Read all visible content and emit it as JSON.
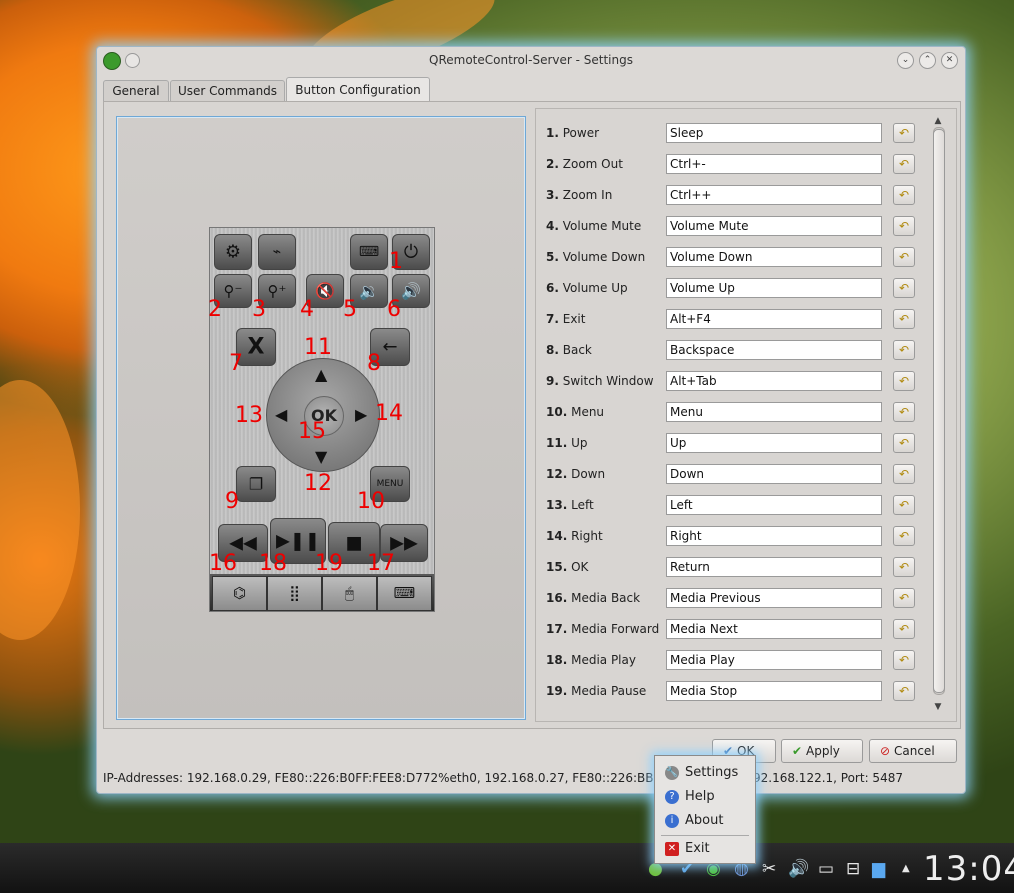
{
  "window": {
    "title": "QRemoteControl-Server - Settings",
    "controls": [
      "⌄",
      "⌃",
      "✕"
    ]
  },
  "tabs": [
    {
      "label": "General"
    },
    {
      "label": "User Commands"
    },
    {
      "label": "Button Configuration",
      "active": true
    }
  ],
  "remote": {
    "numbers": [
      "1",
      "2",
      "3",
      "4",
      "5",
      "6",
      "7",
      "8",
      "9",
      "10",
      "11",
      "12",
      "13",
      "14",
      "15",
      "16",
      "17",
      "18",
      "19"
    ],
    "ok_label": "OK",
    "menu_label": "MENU"
  },
  "buttons": [
    {
      "num": "1.",
      "name": "Power",
      "value": "Sleep"
    },
    {
      "num": "2.",
      "name": "Zoom Out",
      "value": "Ctrl+-"
    },
    {
      "num": "3.",
      "name": "Zoom In",
      "value": "Ctrl++"
    },
    {
      "num": "4.",
      "name": "Volume Mute",
      "value": "Volume Mute"
    },
    {
      "num": "5.",
      "name": "Volume Down",
      "value": "Volume Down"
    },
    {
      "num": "6.",
      "name": "Volume Up",
      "value": "Volume Up"
    },
    {
      "num": "7.",
      "name": "Exit",
      "value": "Alt+F4"
    },
    {
      "num": "8.",
      "name": "Back",
      "value": "Backspace"
    },
    {
      "num": "9.",
      "name": "Switch Window",
      "value": "Alt+Tab"
    },
    {
      "num": "10.",
      "name": "Menu",
      "value": "Menu"
    },
    {
      "num": "11.",
      "name": "Up",
      "value": "Up"
    },
    {
      "num": "12.",
      "name": "Down",
      "value": "Down"
    },
    {
      "num": "13.",
      "name": "Left",
      "value": "Left"
    },
    {
      "num": "14.",
      "name": "Right",
      "value": "Right"
    },
    {
      "num": "15.",
      "name": "OK",
      "value": "Return"
    },
    {
      "num": "16.",
      "name": "Media Back",
      "value": "Media Previous"
    },
    {
      "num": "17.",
      "name": "Media Forward",
      "value": "Media Next"
    },
    {
      "num": "18.",
      "name": "Media Play",
      "value": "Media Play"
    },
    {
      "num": "19.",
      "name": "Media Pause",
      "value": "Media Stop"
    }
  ],
  "dialog_buttons": {
    "ok": "OK",
    "apply": "Apply",
    "cancel": "Cancel"
  },
  "status": "IP-Addresses: 192.168.0.29, FE80::226:B0FF:FEE8:D772%eth0, 192.168.0.27, FE80::226:BBFF:FE0",
  "status_right": "92.168.122.1, Port: 5487",
  "context_menu": {
    "items": [
      {
        "label": "Settings",
        "icon": "wrench-icon"
      },
      {
        "label": "Help",
        "icon": "help-icon"
      },
      {
        "label": "About",
        "icon": "info-icon"
      },
      {
        "label": "Exit",
        "icon": "exit-icon"
      }
    ]
  },
  "taskbar": {
    "clock": "13:04"
  },
  "colors": {
    "accent_glow": "#8cd2ff",
    "number_red": "#e00000",
    "desktop_orange": "#f07a10"
  }
}
